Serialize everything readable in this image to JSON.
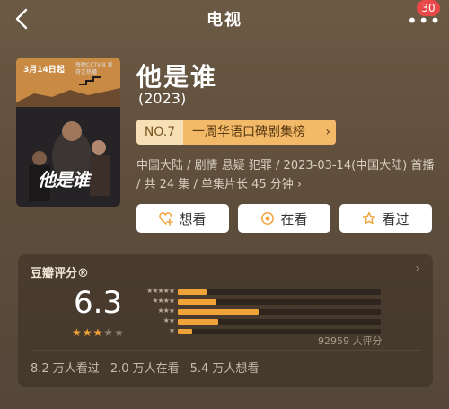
{
  "nav": {
    "title": "电视",
    "badge": "30",
    "back_icon": "chevron-left-icon",
    "more_icon": "ellipsis-icon"
  },
  "poster": {
    "date_text": "3月14日起",
    "sub_text": "每晚CCTV-8 爱奇艺热播",
    "title_text": "他是谁"
  },
  "show": {
    "title": "他是谁",
    "year": "(2023)"
  },
  "rank": {
    "no": "NO.7",
    "label": "一周华语口碑剧集榜",
    "chevron": "›"
  },
  "meta": {
    "text": "中国大陆 / 剧情 悬疑 犯罪 / 2023-03-14(中国大陆) 首播 / 共 24 集 / 单集片长 45 分钟 ›"
  },
  "actions": [
    {
      "label": "想看",
      "icon": "heart-plus-icon"
    },
    {
      "label": "在看",
      "icon": "circle-dot-icon"
    },
    {
      "label": "看过",
      "icon": "star-icon"
    }
  ],
  "rating": {
    "header": "豆瓣评分®",
    "score": "6.3",
    "stars_filled": 3,
    "stars_total": 5,
    "distribution": [
      {
        "stars": 5,
        "label": "★★★★★",
        "fraction": 0.14
      },
      {
        "stars": 4,
        "label": "★★★★",
        "fraction": 0.19
      },
      {
        "stars": 3,
        "label": "★★★",
        "fraction": 0.4
      },
      {
        "stars": 2,
        "label": "★★",
        "fraction": 0.2
      },
      {
        "stars": 1,
        "label": "★",
        "fraction": 0.07
      }
    ],
    "votes": "92959 人评分",
    "stats": [
      "8.2 万人看过",
      "2.0 万人在看",
      "5.4 万人想看"
    ]
  },
  "colors": {
    "accent": "#f0a338",
    "badge": "#e94848",
    "star_active": "#f0a338",
    "star_inactive": "#8c7f6f"
  }
}
